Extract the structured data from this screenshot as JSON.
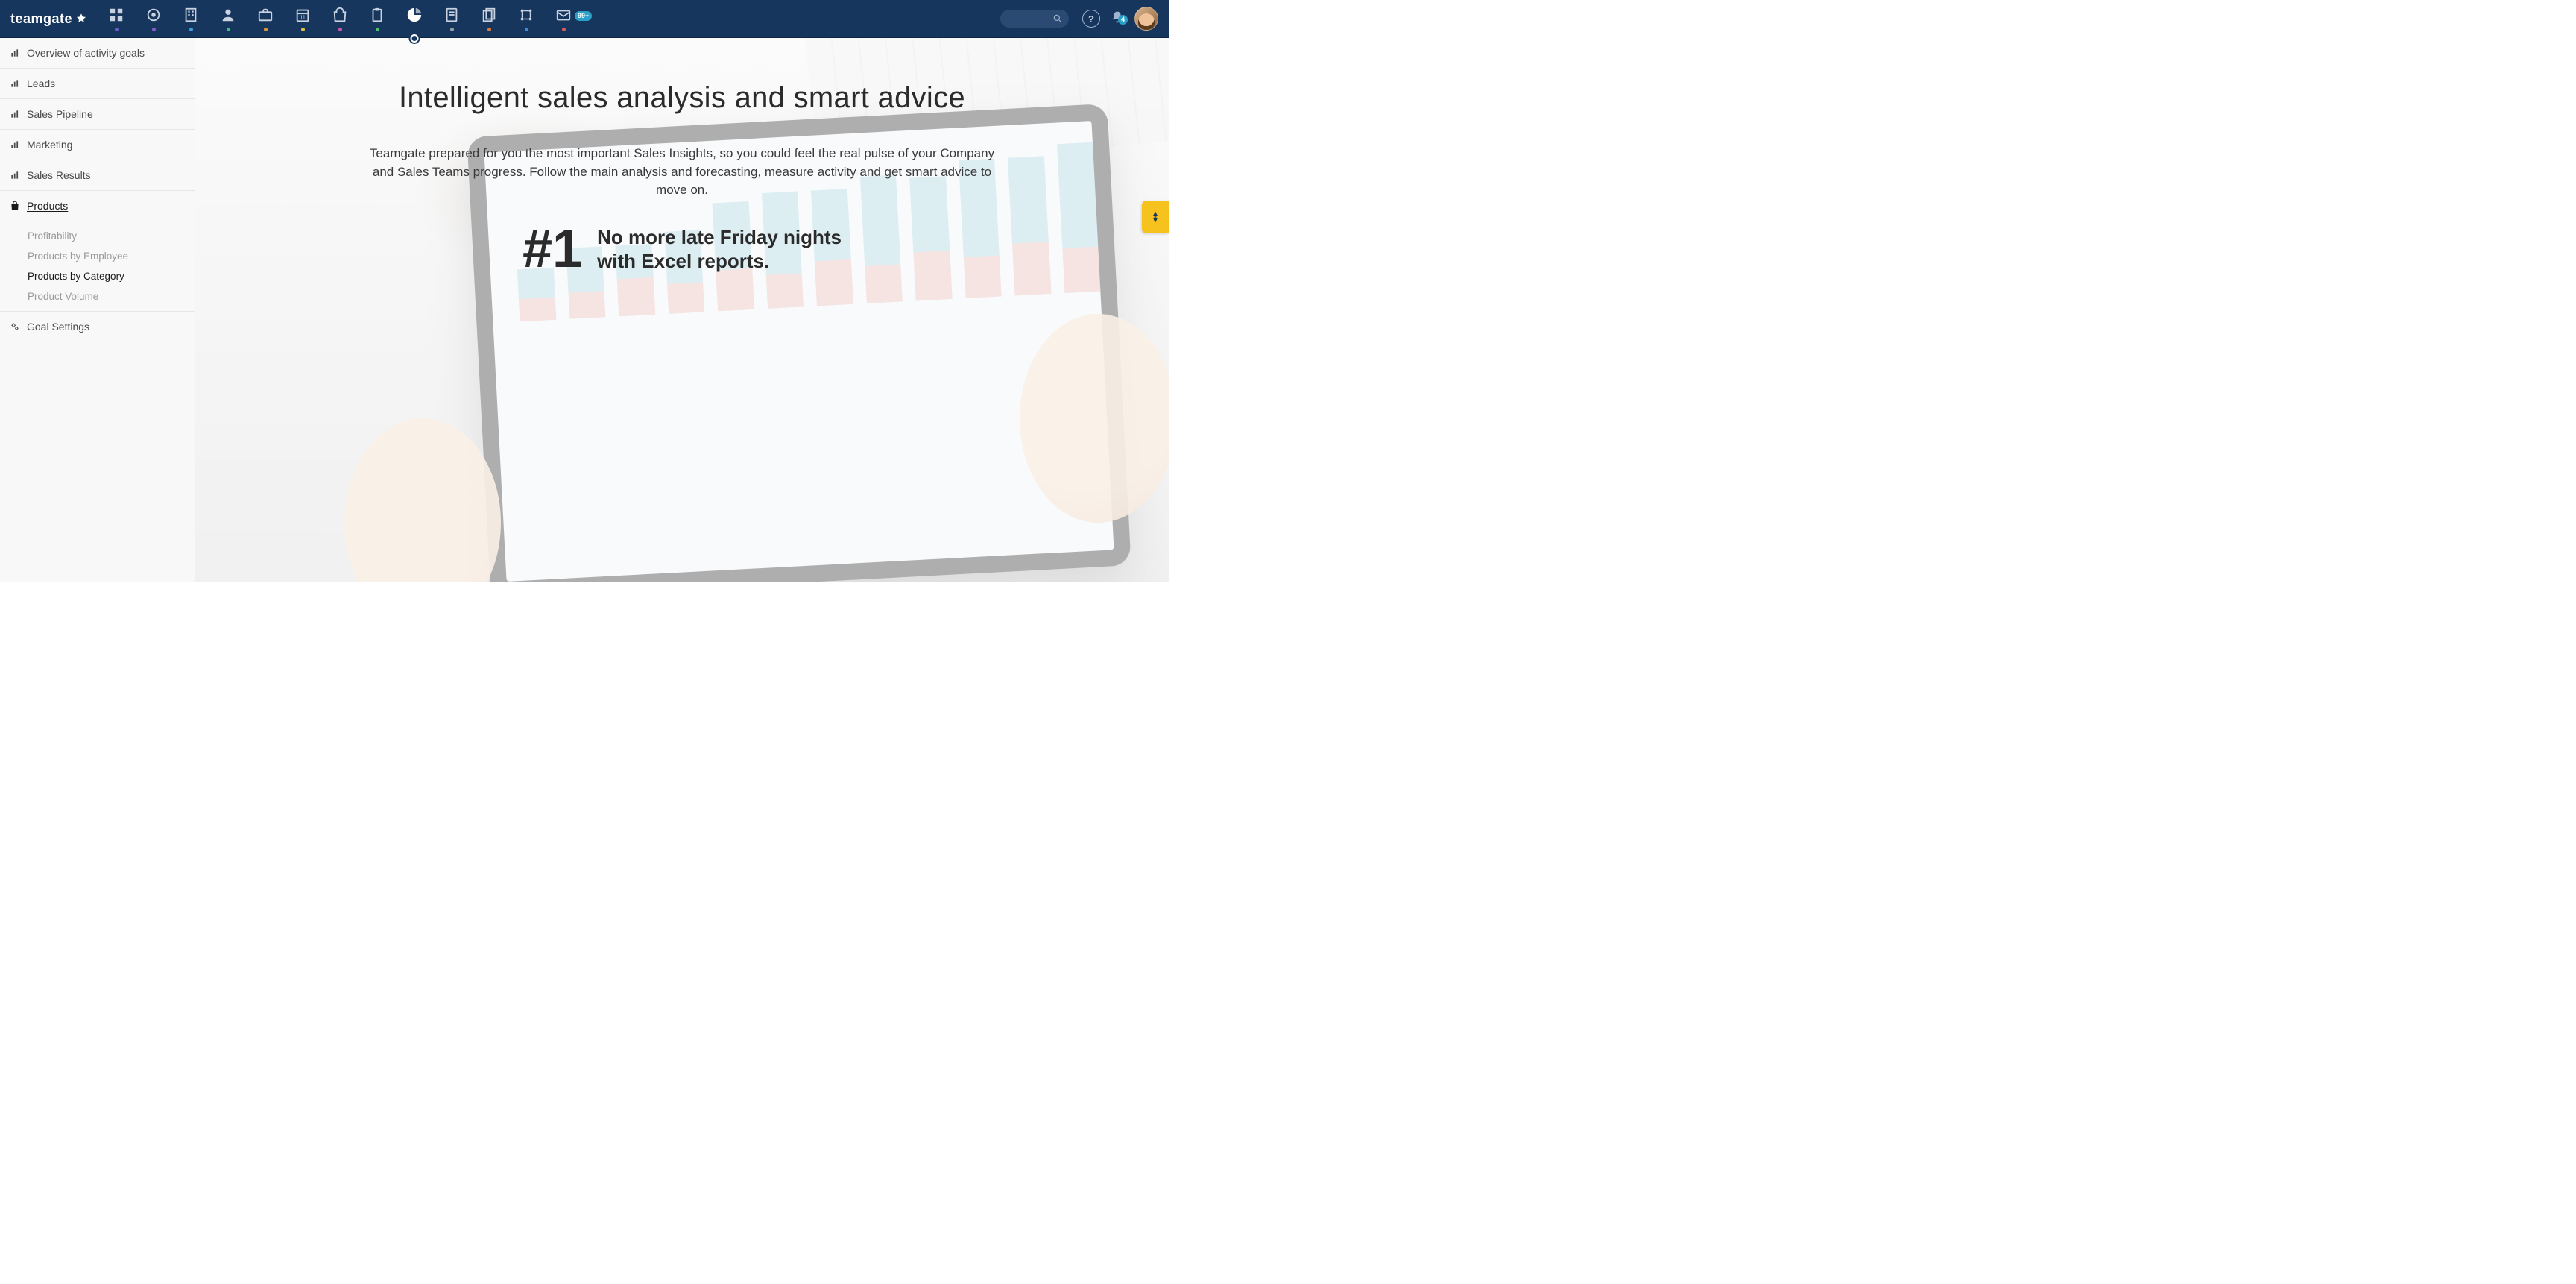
{
  "brand": "teamgate",
  "nav": {
    "items": [
      {
        "name": "dashboard",
        "dot": "#6a5acd"
      },
      {
        "name": "target",
        "dot": "#8a5ad1"
      },
      {
        "name": "company",
        "dot": "#3aa0e0"
      },
      {
        "name": "person",
        "dot": "#3cc27a"
      },
      {
        "name": "briefcase",
        "dot": "#e09a3a"
      },
      {
        "name": "calendar",
        "dot": "#e0c23a"
      },
      {
        "name": "bag",
        "dot": "#d452b8"
      },
      {
        "name": "clip",
        "dot": "#4cc26a"
      },
      {
        "name": "insights",
        "dot": "",
        "active": true
      },
      {
        "name": "note",
        "dot": "#9aa0a6"
      },
      {
        "name": "files",
        "dot": "#e07a3a"
      },
      {
        "name": "flow",
        "dot": "#3a8ae0"
      },
      {
        "name": "mail",
        "dot": "#e05a5a",
        "badge": "99+"
      }
    ],
    "notif_count": "4"
  },
  "sidebar": {
    "items": [
      {
        "label": "Overview of activity goals",
        "icon": "bar"
      },
      {
        "label": "Leads",
        "icon": "bar"
      },
      {
        "label": "Sales Pipeline",
        "icon": "bar"
      },
      {
        "label": "Marketing",
        "icon": "bar"
      },
      {
        "label": "Sales Results",
        "icon": "bar"
      }
    ],
    "products_label": "Products",
    "products_sub": [
      {
        "label": "Profitability"
      },
      {
        "label": "Products by Employee"
      },
      {
        "label": "Products by Category",
        "active": true
      },
      {
        "label": "Product Volume"
      }
    ],
    "goal_settings": "Goal Settings"
  },
  "hero": {
    "title": "Intelligent sales analysis and smart advice",
    "desc": "Teamgate prepared for you the most important Sales Insights, so you could feel the real pulse of your Company and Sales Teams progress. Follow the main analysis and forecasting, measure activity and get smart advice to move on.",
    "tag_num": "#1",
    "tag_line1": "No more late Friday nights",
    "tag_line2": "with Excel reports."
  }
}
